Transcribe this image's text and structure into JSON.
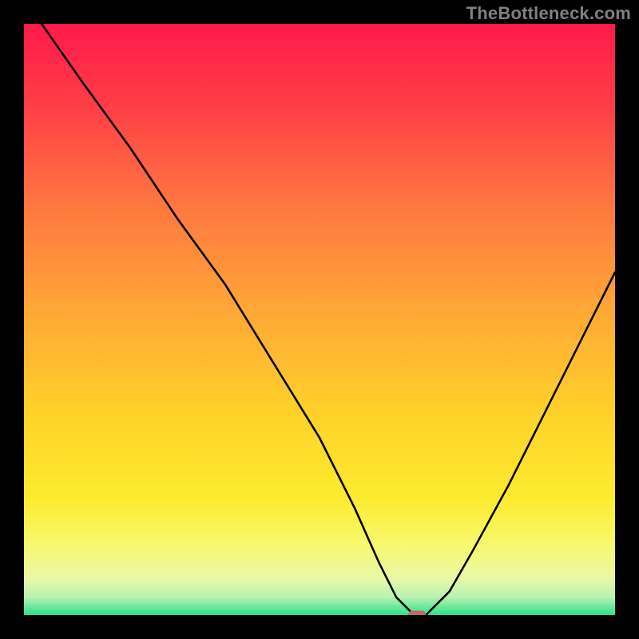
{
  "watermark": "TheBottleneck.com",
  "colors": {
    "page_bg": "#000000",
    "curve": "#000000",
    "marker": "#C26868",
    "gradient_stops": [
      {
        "pct": 0,
        "color": "#FF1A4B"
      },
      {
        "pct": 14,
        "color": "#FF3E46"
      },
      {
        "pct": 30,
        "color": "#FF7540"
      },
      {
        "pct": 48,
        "color": "#FFA636"
      },
      {
        "pct": 66,
        "color": "#FFD22A"
      },
      {
        "pct": 80,
        "color": "#FCEB2C"
      },
      {
        "pct": 88,
        "color": "#F8F86E"
      },
      {
        "pct": 94,
        "color": "#E8F8A8"
      },
      {
        "pct": 97,
        "color": "#B7F2B2"
      },
      {
        "pct": 100,
        "color": "#2DE08A"
      }
    ]
  },
  "chart_data": {
    "type": "line",
    "title": "",
    "xlabel": "",
    "ylabel": "",
    "xlim": [
      0,
      100
    ],
    "ylim": [
      0,
      100
    ],
    "grid": false,
    "series": [
      {
        "name": "curve",
        "x": [
          3,
          10,
          18,
          26,
          34,
          42,
          50,
          56,
          60,
          63,
          66,
          68,
          72,
          76,
          82,
          88,
          94,
          100
        ],
        "values": [
          100,
          90,
          79,
          67,
          56,
          43,
          30,
          18,
          9,
          3,
          0,
          0,
          4,
          11,
          22,
          34,
          46,
          58
        ]
      }
    ],
    "marker": {
      "x": 66.5,
      "y": 0
    }
  }
}
